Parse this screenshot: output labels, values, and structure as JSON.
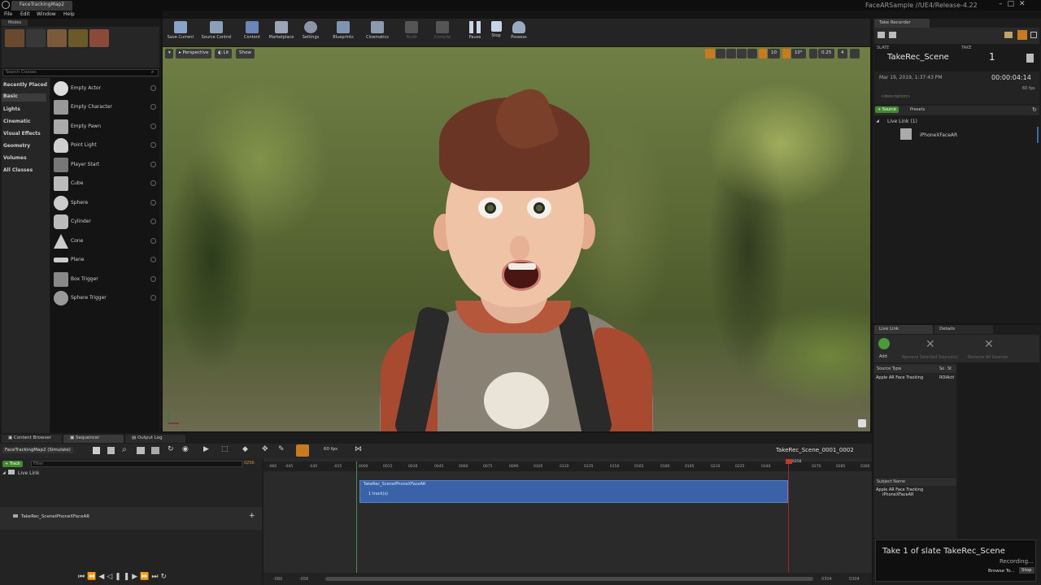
{
  "window": {
    "doc_tab": "FaceTrackingMap2",
    "title": "FaceARSample //UE4/Release-4.22",
    "menu": [
      "File",
      "Edit",
      "Window",
      "Help"
    ]
  },
  "modes": {
    "tab": "Modes",
    "search_placeholder": "Search Classes",
    "categories": [
      "Recently Placed",
      "Basic",
      "Lights",
      "Cinematic",
      "Visual Effects",
      "Geometry",
      "Volumes",
      "All Classes"
    ],
    "actors": [
      "Empty Actor",
      "Empty Character",
      "Empty Pawn",
      "Point Light",
      "Player Start",
      "Cube",
      "Sphere",
      "Cylinder",
      "Cone",
      "Plane",
      "Box Trigger",
      "Sphere Trigger"
    ]
  },
  "toolbar": {
    "items": [
      "Save Current",
      "Source Control",
      "Content",
      "Marketplace",
      "Settings",
      "Blueprints",
      "Cinematics",
      "Build",
      "Compile",
      "Pause",
      "Stop",
      "Possess"
    ]
  },
  "viewport": {
    "perspective": "Perspective",
    "lit": "Lit",
    "show": "Show",
    "grid": "10",
    "angle": "10°",
    "scale": "0.25",
    "camera": "4"
  },
  "take_recorder": {
    "tab": "Take Recorder",
    "slate_label": "SLATE",
    "take_label": "TAKE",
    "slate": "TakeRec_Scene",
    "take": "1",
    "date": "Mar 19, 2019, 1:37:43 PM",
    "timecode": "00:00:04:14",
    "fps": "60 fps",
    "description": "<description>",
    "source_btn": "+ Source",
    "presets": "Presets",
    "group": "Live Link (1)",
    "source_item": "iPhoneXFaceAR"
  },
  "live_link": {
    "tab": "Live Link",
    "details_tab": "Details",
    "add": "Add",
    "remove_selected": "Remove Selected Source(s)",
    "remove_all": "Remove All Sources",
    "col_source_type": "Source Type",
    "col_so": "So",
    "col_st": "St",
    "row_type": "Apple AR Face Tracking",
    "row_status": "ROIActi",
    "subject_header": "Subject Name",
    "subject_group": "Apple AR Face Tracking",
    "subject_item": "iPhoneXFaceAR"
  },
  "toast": {
    "title": "Take 1 of slate TakeRec_Scene",
    "status": "Recording...",
    "browse": "Browse To...",
    "stop": "Stop"
  },
  "bottom": {
    "tabs": [
      "Content Browser",
      "Sequencer",
      "Output Log"
    ],
    "map_select": "FaceTrackingMap2 (Simulate)",
    "fps": "60 fps",
    "sequence_name": "TakeRec_Scene_0001_0002",
    "track_btn": "+ Track",
    "filter_placeholder": "Filter",
    "current_frame": "0256",
    "ruler_current": "0256",
    "group": "Live Link",
    "track": "TakeRec_SceneiPhoneXFaceAR",
    "clip_title": "TakeRec_SceneiPhoneXFaceAR",
    "clip_sub": "1 track(s)",
    "ticks": [
      "-060",
      "-045",
      "-030",
      "-015",
      "0000",
      "0015",
      "0030",
      "0045",
      "0060",
      "0075",
      "0090",
      "0105",
      "0120",
      "0135",
      "0150",
      "0165",
      "0180",
      "0195",
      "0210",
      "0225",
      "0240",
      "0256",
      "0270",
      "0285",
      "0300"
    ],
    "range_start": "-060",
    "range_start2": "-056",
    "range_end": "0304",
    "range_end2": "0304"
  }
}
